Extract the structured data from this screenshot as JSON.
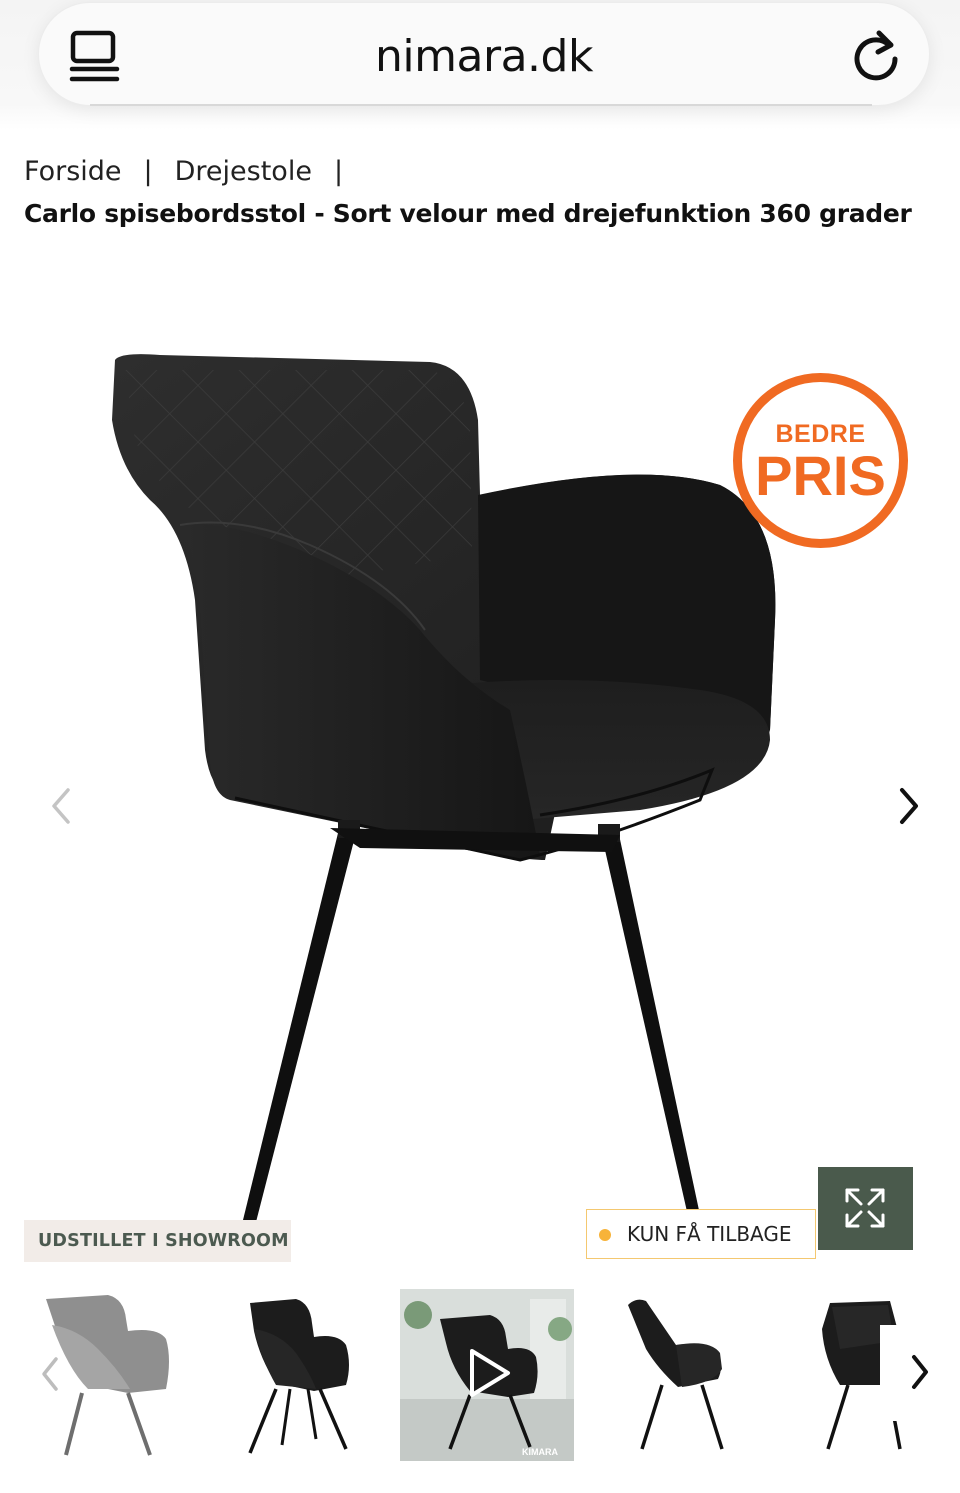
{
  "browser": {
    "domain": "nimara.dk"
  },
  "breadcrumb": {
    "items": [
      "Forside",
      "Drejestole"
    ],
    "separator": "|"
  },
  "product": {
    "title": "Carlo spisebordsstol - Sort velour med drejefunktion 360 grader"
  },
  "badges": {
    "price_small": "BEDRE",
    "price_big": "PRIS",
    "showroom": "UDSTILLET I SHOWROOM",
    "stock": "KUN FÅ TILBAGE",
    "watermark": "KIMARA"
  },
  "gallery": {
    "thumbnail_count": 5,
    "active_thumbnail_index": 2,
    "colors": {
      "accent_orange": "#f06a22",
      "expand_button_bg": "#4a5a4c",
      "stock_dot": "#f7b339",
      "showroom_text": "#4c5a50"
    }
  }
}
